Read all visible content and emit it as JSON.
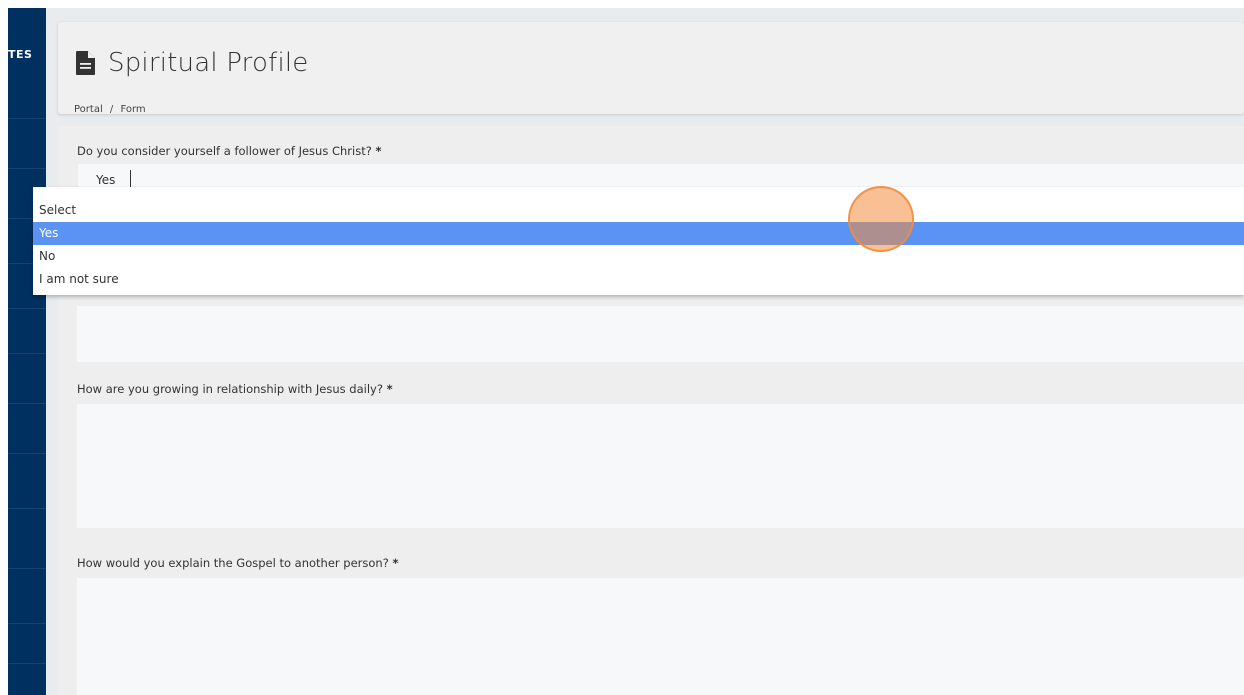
{
  "sidebar": {
    "logo_text": "TES"
  },
  "header": {
    "title": "Spiritual Profile",
    "breadcrumb": {
      "portal": "Portal",
      "separator": "/",
      "current": "Form"
    }
  },
  "questions": [
    {
      "label": "Do you consider yourself a follower of Jesus Christ?",
      "required_mark": "*"
    },
    {
      "label": "How are you growing in relationship with Jesus daily?",
      "required_mark": "*"
    },
    {
      "label": "How would you explain the Gospel to another person?",
      "required_mark": "*"
    }
  ],
  "select": {
    "current_value": "Yes",
    "options": [
      "Select",
      "Yes",
      "No",
      "I am not sure"
    ],
    "highlighted_option": "Yes"
  },
  "icons": {
    "page_title_icon": "document-icon"
  },
  "colors": {
    "sidebar_bg": "#00305f",
    "highlight_bg": "#5b93f5",
    "click_indicator": "#f28c3c"
  }
}
